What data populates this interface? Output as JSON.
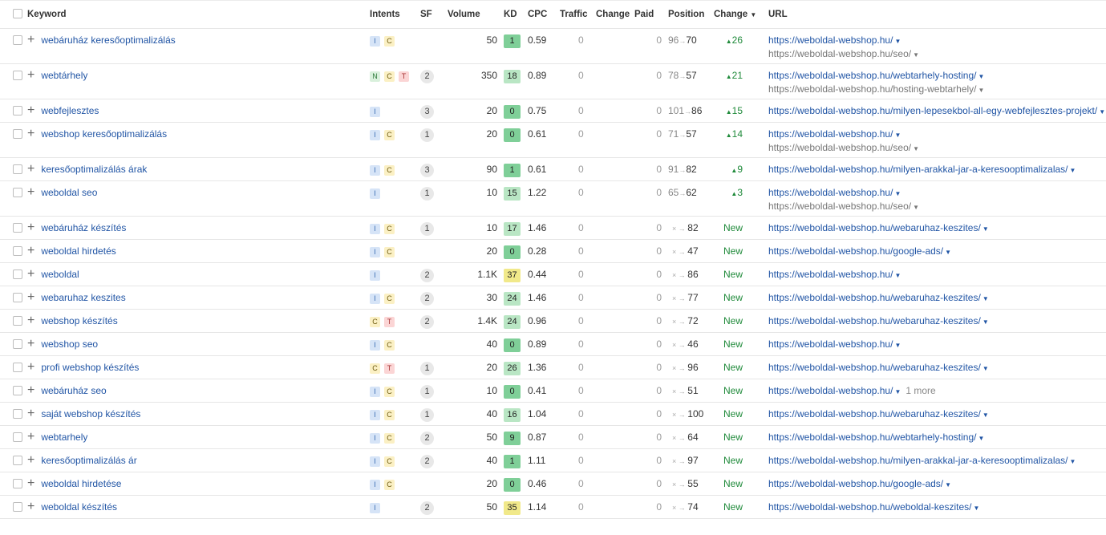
{
  "headers": {
    "keyword": "Keyword",
    "intents": "Intents",
    "sf": "SF",
    "volume": "Volume",
    "kd": "KD",
    "cpc": "CPC",
    "traffic": "Traffic",
    "change": "Change",
    "paid": "Paid",
    "position": "Position",
    "change2": "Change",
    "url": "URL"
  },
  "colors": {
    "kd_green_dark": "#7fcf98",
    "kd_green_light": "#b9e6c4",
    "kd_yellow": "#f1e98a",
    "link": "#2155a5",
    "positive": "#1f8a3a"
  },
  "rows": [
    {
      "keyword": "webáruház keresőoptimalizálás",
      "intents": [
        "I",
        "C"
      ],
      "sf": "",
      "volume": "50",
      "kd": "1",
      "cpc": "0.59",
      "traffic": "0",
      "paid": "0",
      "pos_old": "96",
      "pos_new": "70",
      "change": "26",
      "is_new": false,
      "url": "https://weboldal-webshop.hu/",
      "url2": "https://weboldal-webshop.hu/seo/",
      "more": ""
    },
    {
      "keyword": "webtárhely",
      "intents": [
        "N",
        "C",
        "T"
      ],
      "sf": "2",
      "volume": "350",
      "kd": "18",
      "cpc": "0.89",
      "traffic": "0",
      "paid": "0",
      "pos_old": "78",
      "pos_new": "57",
      "change": "21",
      "is_new": false,
      "url": "https://weboldal-webshop.hu/webtarhely-hosting/",
      "url2": "https://weboldal-webshop.hu/hosting-webtarhely/",
      "more": ""
    },
    {
      "keyword": "webfejlesztes",
      "intents": [
        "I"
      ],
      "sf": "3",
      "volume": "20",
      "kd": "0",
      "cpc": "0.75",
      "traffic": "0",
      "paid": "0",
      "pos_old": "101",
      "pos_new": "86",
      "change": "15",
      "is_new": false,
      "url": "https://weboldal-webshop.hu/milyen-lepesekbol-all-egy-webfejlesztes-projekt/",
      "url2": "",
      "more": ""
    },
    {
      "keyword": "webshop keresőoptimalizálás",
      "intents": [
        "I",
        "C"
      ],
      "sf": "1",
      "volume": "20",
      "kd": "0",
      "cpc": "0.61",
      "traffic": "0",
      "paid": "0",
      "pos_old": "71",
      "pos_new": "57",
      "change": "14",
      "is_new": false,
      "url": "https://weboldal-webshop.hu/",
      "url2": "https://weboldal-webshop.hu/seo/",
      "more": ""
    },
    {
      "keyword": "keresőoptimalizálás árak",
      "intents": [
        "I",
        "C"
      ],
      "sf": "3",
      "volume": "90",
      "kd": "1",
      "cpc": "0.61",
      "traffic": "0",
      "paid": "0",
      "pos_old": "91",
      "pos_new": "82",
      "change": "9",
      "is_new": false,
      "url": "https://weboldal-webshop.hu/milyen-arakkal-jar-a-keresooptimalizalas/",
      "url2": "",
      "more": ""
    },
    {
      "keyword": "weboldal seo",
      "intents": [
        "I"
      ],
      "sf": "1",
      "volume": "10",
      "kd": "15",
      "cpc": "1.22",
      "traffic": "0",
      "paid": "0",
      "pos_old": "65",
      "pos_new": "62",
      "change": "3",
      "is_new": false,
      "url": "https://weboldal-webshop.hu/",
      "url2": "https://weboldal-webshop.hu/seo/",
      "more": ""
    },
    {
      "keyword": "webáruház készítés",
      "intents": [
        "I",
        "C"
      ],
      "sf": "1",
      "volume": "10",
      "kd": "17",
      "cpc": "1.46",
      "traffic": "0",
      "paid": "0",
      "pos_old": "×",
      "pos_new": "82",
      "change": "New",
      "is_new": true,
      "url": "https://weboldal-webshop.hu/webaruhaz-keszites/",
      "url2": "",
      "more": ""
    },
    {
      "keyword": "weboldal hirdetés",
      "intents": [
        "I",
        "C"
      ],
      "sf": "",
      "volume": "20",
      "kd": "0",
      "cpc": "0.28",
      "traffic": "0",
      "paid": "0",
      "pos_old": "×",
      "pos_new": "47",
      "change": "New",
      "is_new": true,
      "url": "https://weboldal-webshop.hu/google-ads/",
      "url2": "",
      "more": ""
    },
    {
      "keyword": "weboldal",
      "intents": [
        "I"
      ],
      "sf": "2",
      "volume": "1.1K",
      "kd": "37",
      "cpc": "0.44",
      "traffic": "0",
      "paid": "0",
      "pos_old": "×",
      "pos_new": "86",
      "change": "New",
      "is_new": true,
      "url": "https://weboldal-webshop.hu/",
      "url2": "",
      "more": ""
    },
    {
      "keyword": "webaruhaz keszites",
      "intents": [
        "I",
        "C"
      ],
      "sf": "2",
      "volume": "30",
      "kd": "24",
      "cpc": "1.46",
      "traffic": "0",
      "paid": "0",
      "pos_old": "×",
      "pos_new": "77",
      "change": "New",
      "is_new": true,
      "url": "https://weboldal-webshop.hu/webaruhaz-keszites/",
      "url2": "",
      "more": ""
    },
    {
      "keyword": "webshop készítés",
      "intents": [
        "C",
        "T"
      ],
      "sf": "2",
      "volume": "1.4K",
      "kd": "24",
      "cpc": "0.96",
      "traffic": "0",
      "paid": "0",
      "pos_old": "×",
      "pos_new": "72",
      "change": "New",
      "is_new": true,
      "url": "https://weboldal-webshop.hu/webaruhaz-keszites/",
      "url2": "",
      "more": ""
    },
    {
      "keyword": "webshop seo",
      "intents": [
        "I",
        "C"
      ],
      "sf": "",
      "volume": "40",
      "kd": "0",
      "cpc": "0.89",
      "traffic": "0",
      "paid": "0",
      "pos_old": "×",
      "pos_new": "46",
      "change": "New",
      "is_new": true,
      "url": "https://weboldal-webshop.hu/",
      "url2": "",
      "more": ""
    },
    {
      "keyword": "profi webshop készítés",
      "intents": [
        "C",
        "T"
      ],
      "sf": "1",
      "volume": "20",
      "kd": "26",
      "cpc": "1.36",
      "traffic": "0",
      "paid": "0",
      "pos_old": "×",
      "pos_new": "96",
      "change": "New",
      "is_new": true,
      "url": "https://weboldal-webshop.hu/webaruhaz-keszites/",
      "url2": "",
      "more": ""
    },
    {
      "keyword": "webáruház seo",
      "intents": [
        "I",
        "C"
      ],
      "sf": "1",
      "volume": "10",
      "kd": "0",
      "cpc": "0.41",
      "traffic": "0",
      "paid": "0",
      "pos_old": "×",
      "pos_new": "51",
      "change": "New",
      "is_new": true,
      "url": "https://weboldal-webshop.hu/",
      "url2": "",
      "more": "1 more"
    },
    {
      "keyword": "saját webshop készítés",
      "intents": [
        "I",
        "C"
      ],
      "sf": "1",
      "volume": "40",
      "kd": "16",
      "cpc": "1.04",
      "traffic": "0",
      "paid": "0",
      "pos_old": "×",
      "pos_new": "100",
      "change": "New",
      "is_new": true,
      "url": "https://weboldal-webshop.hu/webaruhaz-keszites/",
      "url2": "",
      "more": ""
    },
    {
      "keyword": "webtarhely",
      "intents": [
        "I",
        "C"
      ],
      "sf": "2",
      "volume": "50",
      "kd": "9",
      "cpc": "0.87",
      "traffic": "0",
      "paid": "0",
      "pos_old": "×",
      "pos_new": "64",
      "change": "New",
      "is_new": true,
      "url": "https://weboldal-webshop.hu/webtarhely-hosting/",
      "url2": "",
      "more": ""
    },
    {
      "keyword": "keresőoptimalizálás ár",
      "intents": [
        "I",
        "C"
      ],
      "sf": "2",
      "volume": "40",
      "kd": "1",
      "cpc": "1.11",
      "traffic": "0",
      "paid": "0",
      "pos_old": "×",
      "pos_new": "97",
      "change": "New",
      "is_new": true,
      "url": "https://weboldal-webshop.hu/milyen-arakkal-jar-a-keresooptimalizalas/",
      "url2": "",
      "more": ""
    },
    {
      "keyword": "weboldal hirdetése",
      "intents": [
        "I",
        "C"
      ],
      "sf": "",
      "volume": "20",
      "kd": "0",
      "cpc": "0.46",
      "traffic": "0",
      "paid": "0",
      "pos_old": "×",
      "pos_new": "55",
      "change": "New",
      "is_new": true,
      "url": "https://weboldal-webshop.hu/google-ads/",
      "url2": "",
      "more": ""
    },
    {
      "keyword": "weboldal készítés",
      "intents": [
        "I"
      ],
      "sf": "2",
      "volume": "50",
      "kd": "35",
      "cpc": "1.14",
      "traffic": "0",
      "paid": "0",
      "pos_old": "×",
      "pos_new": "74",
      "change": "New",
      "is_new": true,
      "url": "https://weboldal-webshop.hu/weboldal-keszites/",
      "url2": "",
      "more": ""
    }
  ]
}
